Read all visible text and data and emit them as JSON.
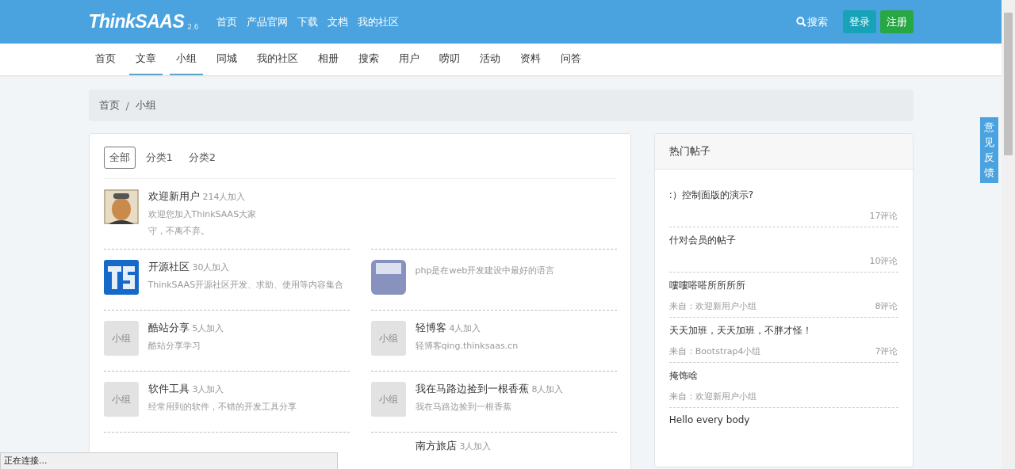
{
  "header": {
    "logo": "ThinkSAAS",
    "version": "2.6",
    "links": [
      "首页",
      "产品官网",
      "下载",
      "文档",
      "我的社区"
    ],
    "search": "搜索",
    "login": "登录",
    "register": "注册"
  },
  "subnav": [
    {
      "label": "首页",
      "underlined": false
    },
    {
      "label": "文章",
      "underlined": true
    },
    {
      "label": "小组",
      "underlined": true
    },
    {
      "label": "同城",
      "underlined": false
    },
    {
      "label": "我的社区",
      "underlined": false
    },
    {
      "label": "相册",
      "underlined": false
    },
    {
      "label": "搜索",
      "underlined": false
    },
    {
      "label": "用户",
      "underlined": false
    },
    {
      "label": "唠叨",
      "underlined": false
    },
    {
      "label": "活动",
      "underlined": false
    },
    {
      "label": "资料",
      "underlined": false
    },
    {
      "label": "问答",
      "underlined": false
    }
  ],
  "breadcrumb": {
    "items": [
      "首页",
      "小组"
    ],
    "separator": "/"
  },
  "filters": [
    {
      "label": "全部",
      "selected": true
    },
    {
      "label": "分类1",
      "selected": false
    },
    {
      "label": "分类2",
      "selected": false
    }
  ],
  "groups": [
    {
      "kind": "avatar",
      "name": "欢迎新用户",
      "members": "214人加入",
      "description_lines": [
        "欢迎您加入ThinkSAAS大家",
        "守，不离不弃。"
      ]
    },
    {
      "kind": "hidden"
    },
    {
      "kind": "ts",
      "name": "开源社区",
      "members": "30人加入",
      "description_lines": [
        "ThinkSAAS开源社区开发、求助、使用等内容集合"
      ]
    },
    {
      "kind": "php",
      "description_lines": [
        "php是在web开发建设中最好的语言"
      ]
    },
    {
      "kind": "placeholder",
      "thumb": "小组",
      "name": "酷站分享",
      "members": "5人加入",
      "description_lines": [
        "酷站分享学习"
      ]
    },
    {
      "kind": "placeholder",
      "thumb": "小组",
      "name": "轻博客",
      "members": "4人加入",
      "description_lines": [
        "轻博客qing.thinksaas.cn"
      ]
    },
    {
      "kind": "placeholder",
      "thumb": "小组",
      "name": "软件工具",
      "members": "3人加入",
      "description_lines": [
        "经常用到的软件，不错的开发工具分享"
      ]
    },
    {
      "kind": "placeholder",
      "thumb": "小组",
      "name": "我在马路边捡到一根香蕉",
      "members": "8人加入",
      "description_lines": [
        "我在马路边捡到一根香蕉"
      ]
    },
    {
      "kind": "hidden"
    },
    {
      "kind": "cut",
      "name": "南方旅店",
      "members": "3人加入"
    }
  ],
  "hot_posts": {
    "title": "热门帖子",
    "posts": [
      {
        "title": ":）控制面版的演示?",
        "comments": "17评论"
      },
      {
        "title": "什对会员的帖子",
        "comments": "10评论"
      },
      {
        "title": "嘍嘍嗒嗒所所所所",
        "source": "来自：欢迎新用户小组",
        "comments": "8评论"
      },
      {
        "title": "天天加班，天天加班，不胖才怪！",
        "source": "来自：Bootstrap4小组",
        "comments": "7评论"
      },
      {
        "title": "掩饰啥",
        "source": "来自：欢迎新用户小组"
      },
      {
        "title": "Hello every body"
      }
    ]
  },
  "feedback": "意见反馈",
  "status_bar": "正在连接..."
}
